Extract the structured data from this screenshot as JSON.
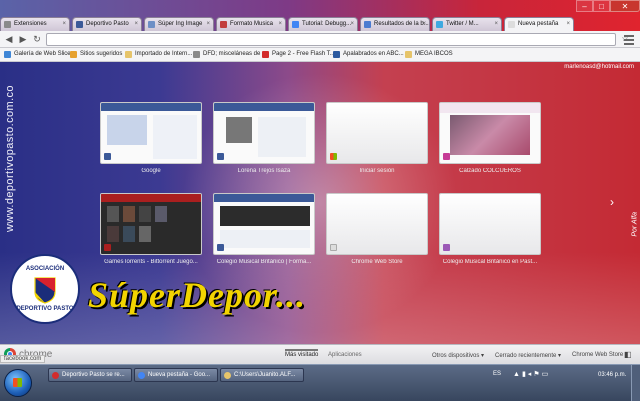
{
  "tabs": [
    {
      "label": "Extensiones",
      "icon": "puzzle-icon",
      "color": "#8a8a8a"
    },
    {
      "label": "Deportivo Pasto",
      "icon": "facebook-icon",
      "color": "#3b5998"
    },
    {
      "label": "Súper Ing Image",
      "icon": "image-icon",
      "color": "#6d8fc6"
    },
    {
      "label": "Formato Musica",
      "icon": "page-icon",
      "color": "#c23e3e"
    },
    {
      "label": "Tutorial: Debugg...",
      "icon": "chrome-icon",
      "color": "#4285f4"
    },
    {
      "label": "Resultados de la b...",
      "icon": "search-icon",
      "color": "#4a7bd0"
    },
    {
      "label": "Twitter / M...",
      "icon": "twitter-icon",
      "color": "#3fa9e0"
    },
    {
      "label": "Nueva pestaña",
      "icon": "blank-icon",
      "color": "#dddddd"
    }
  ],
  "bookmarks": [
    {
      "label": "Galería de Web Slice",
      "color": "#3f86d6"
    },
    {
      "label": "Sitios sugeridos",
      "color": "#e6a12f"
    },
    {
      "label": "Importado de Intern...",
      "color": "#e6c46a"
    },
    {
      "label": "DFD; misceláneas de ...",
      "color": "#8a8a8a"
    },
    {
      "label": "Page 2 - Free Flash T...",
      "color": "#d22c2c"
    },
    {
      "label": "Apalabrados en ABC...",
      "color": "#2c5aa0"
    },
    {
      "label": "MEGA IBCOS",
      "color": "#e6c46a"
    }
  ],
  "user_email": "marlenoasd@hotmail.com",
  "side_url": "www.deportivopasto.com.co",
  "side_credit": "Por Alfa",
  "thumbnails": [
    {
      "caption": "Google",
      "color": "#3b5998"
    },
    {
      "caption": "Lorena Trejos Isaza",
      "color": "#3b5998"
    },
    {
      "caption": "Iniciar sesión",
      "color": "#e6a12f"
    },
    {
      "caption": "Calzado COLCUEROS",
      "color": "#c63c96"
    },
    {
      "caption": "GamesTorrents - Bittorrent Juego...",
      "color": "#aa1f1f"
    },
    {
      "caption": "Colegio Musical Británico | Forma...",
      "color": "#3b5998"
    },
    {
      "caption": "Chrome Web Store",
      "color": "#dddddd"
    },
    {
      "caption": "Colegio Musical Británico en Past...",
      "color": "#9b59b6"
    }
  ],
  "logo": {
    "top_text": "ASOCIACIÓN",
    "bottom_text": "DEPORTIVO PASTO"
  },
  "banner_text": "SúperDepor...",
  "footer": {
    "brand": "chrome",
    "tab_most_visited": "Más visitado",
    "tab_apps": "Aplicaciones",
    "other_devices": "Otros dispositivos",
    "recently_closed": "Cerrado recientemente",
    "web_store": "Chrome Web Store",
    "status_url": "facebook.com"
  },
  "taskbar": {
    "tasks": [
      {
        "label": "Deportivo Pasto se re...",
        "color": "#d22c2c"
      },
      {
        "label": "Nueva pestaña - Goo...",
        "color": "#4285f4"
      },
      {
        "label": "C:\\Users\\Juanito.ALF...",
        "color": "#e6c46a"
      }
    ],
    "lang": "ES",
    "clock": "03:46 p.m."
  },
  "colors": {
    "accent_red": "#c42a34",
    "accent_blue": "#2a2f86",
    "banner_yellow": "#f2d400"
  }
}
